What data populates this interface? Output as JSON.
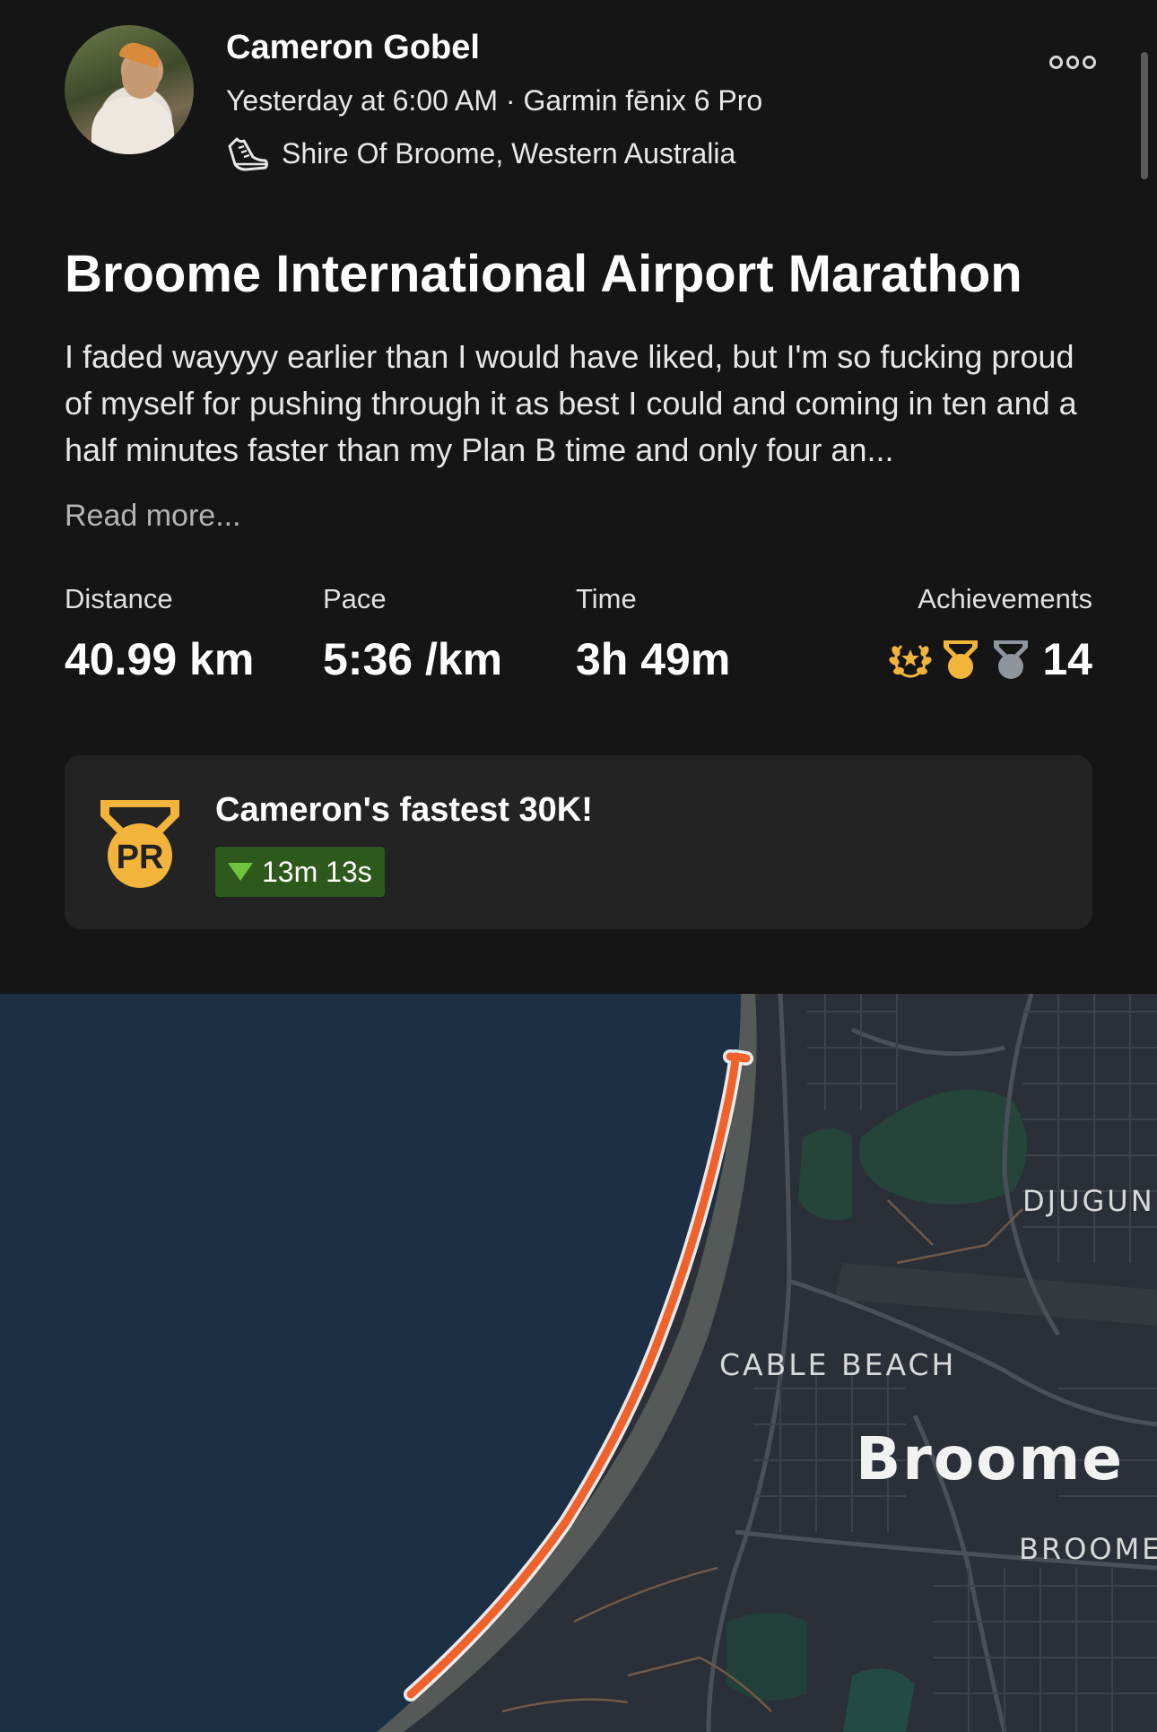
{
  "header": {
    "athlete_name": "Cameron Gobel",
    "meta": "Yesterday at 6:00 AM · Garmin fēnix 6 Pro",
    "location": "Shire Of Broome, Western Australia",
    "activity_icon": "run-shoe-icon",
    "more_icon": "more-options-icon"
  },
  "activity": {
    "title": "Broome International Airport Marathon",
    "description": "I faded wayyyy earlier than I would have liked, but I'm so fucking proud of myself for pushing through it as best I could and coming in ten and a half minutes faster than my Plan B time and only four an...",
    "read_more": "Read more..."
  },
  "stats": {
    "distance": {
      "label": "Distance",
      "value": "40.99 km"
    },
    "pace": {
      "label": "Pace",
      "value": "5:36 /km"
    },
    "time": {
      "label": "Time",
      "value": "3h 49m"
    },
    "achievements": {
      "label": "Achievements",
      "count": "14",
      "icons": [
        "laurel-wreath-icon",
        "gold-medal-icon",
        "silver-medal-icon"
      ]
    }
  },
  "pr_card": {
    "badge_text": "PR",
    "title": "Cameron's fastest 30K!",
    "delta": "13m 13s",
    "delta_icon": "down-triangle-icon"
  },
  "map": {
    "labels": {
      "djugun": "DJUGUN",
      "cable_beach": "CABLE BEACH",
      "broome": "Broome",
      "broome_town": "BROOME"
    }
  },
  "colors": {
    "background": "#151516",
    "card": "#232324",
    "route": "#f0622c",
    "gold": "#f2b43a",
    "silver": "#8e959c",
    "pr_green": "#2d5a1c",
    "pr_green_icon": "#6ec33f",
    "ocean": "#1c2f45",
    "land": "#2b2f37"
  }
}
